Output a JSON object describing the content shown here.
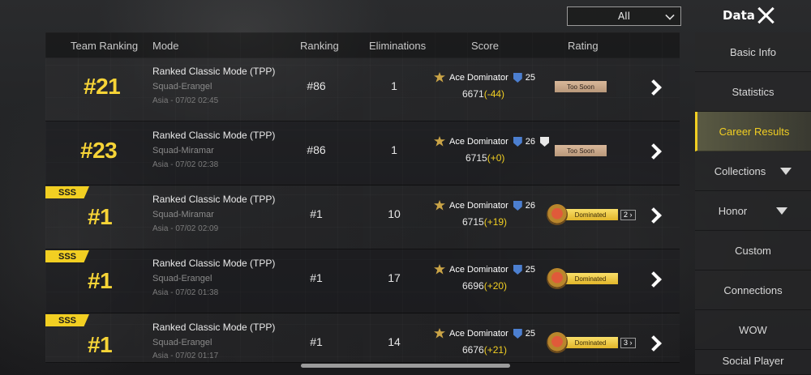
{
  "filter": {
    "value": "All"
  },
  "header": {
    "title": "Data"
  },
  "columns": {
    "team_ranking": "Team Ranking",
    "mode": "Mode",
    "ranking": "Ranking",
    "eliminations": "Eliminations",
    "score": "Score",
    "rating": "Rating"
  },
  "rows": [
    {
      "badge": "",
      "team_rank": "#21",
      "mode": "Ranked Classic Mode (TPP)",
      "squad": "Squad-Erangel",
      "meta": "Asia - 07/02 02:45",
      "ranking": "#86",
      "eliminations": "1",
      "tier": "Ace Dominator",
      "tier_level": "25",
      "score": "6671",
      "delta": "(-44)",
      "rating": "Too Soon",
      "rating_count": ""
    },
    {
      "badge": "",
      "team_rank": "#23",
      "mode": "Ranked Classic Mode (TPP)",
      "squad": "Squad-Miramar",
      "meta": "Asia - 07/02 02:38",
      "ranking": "#86",
      "eliminations": "1",
      "tier": "Ace Dominator",
      "tier_level": "26",
      "score": "6715",
      "delta": "(+0)",
      "rating": "Too Soon",
      "rating_count": ""
    },
    {
      "badge": "SSS",
      "team_rank": "#1",
      "mode": "Ranked Classic Mode (TPP)",
      "squad": "Squad-Miramar",
      "meta": "Asia - 07/02 02:09",
      "ranking": "#1",
      "eliminations": "10",
      "tier": "Ace Dominator",
      "tier_level": "26",
      "score": "6715",
      "delta": "(+19)",
      "rating": "Dominated",
      "rating_count": "2"
    },
    {
      "badge": "SSS",
      "team_rank": "#1",
      "mode": "Ranked Classic Mode (TPP)",
      "squad": "Squad-Erangel",
      "meta": "Asia - 07/02 01:38",
      "ranking": "#1",
      "eliminations": "17",
      "tier": "Ace Dominator",
      "tier_level": "25",
      "score": "6696",
      "delta": "(+20)",
      "rating": "Dominated",
      "rating_count": ""
    },
    {
      "badge": "SSS",
      "team_rank": "#1",
      "mode": "Ranked Classic Mode (TPP)",
      "squad": "Squad-Erangel",
      "meta": "Asia - 07/02 01:17",
      "ranking": "#1",
      "eliminations": "14",
      "tier": "Ace Dominator",
      "tier_level": "25",
      "score": "6676",
      "delta": "(+21)",
      "rating": "Dominated",
      "rating_count": "3"
    }
  ],
  "sidebar": {
    "items": [
      {
        "label": "Basic Info",
        "active": false
      },
      {
        "label": "Statistics",
        "active": false
      },
      {
        "label": "Career Results",
        "active": true
      },
      {
        "label": "Collections",
        "active": false
      },
      {
        "label": "Honor",
        "active": false
      },
      {
        "label": "Custom",
        "active": false
      },
      {
        "label": "Connections",
        "active": false
      },
      {
        "label": "WOW",
        "active": false
      },
      {
        "label": "Social Player",
        "active": false
      }
    ]
  },
  "icons": {
    "close": "close-icon",
    "dropdown": "chevron-down-icon",
    "details": "chevron-right-icon",
    "tier": "ace-dominator-icon",
    "dominated": "dominated-medal-icon"
  },
  "colors": {
    "accent": "#f2cf22",
    "negative_text": "#f2cf22"
  }
}
